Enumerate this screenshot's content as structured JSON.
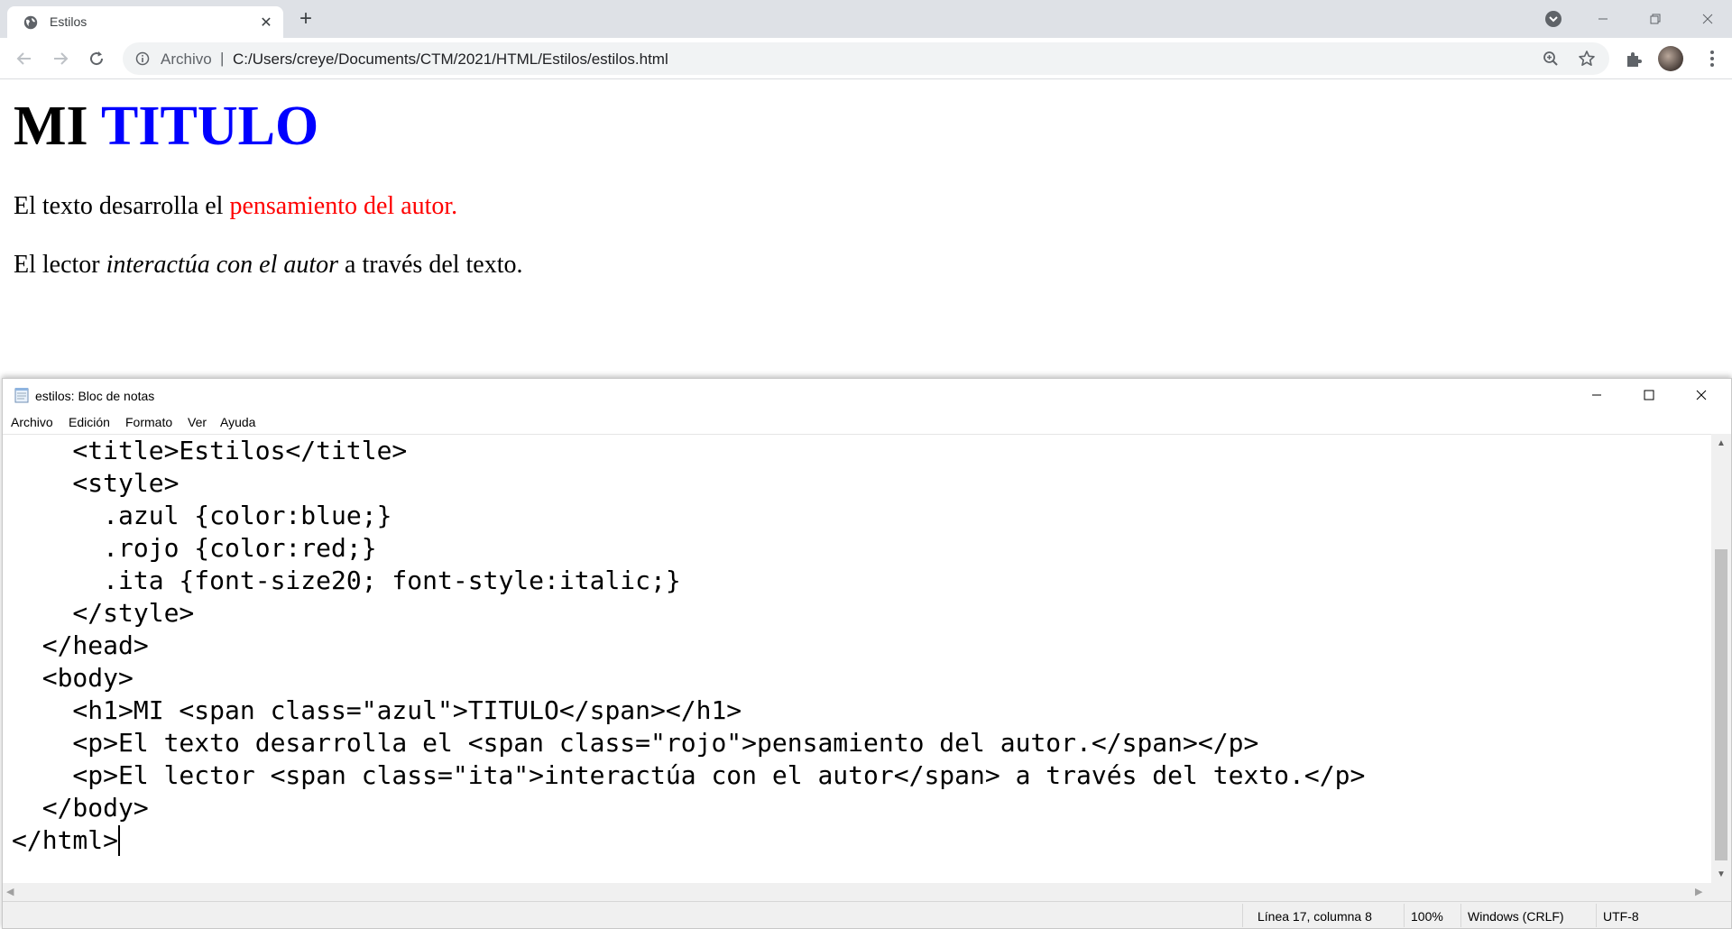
{
  "browser": {
    "tab_title": "Estilos",
    "scheme_label": "Archivo",
    "separator": "|",
    "url": "C:/Users/creye/Documents/CTM/2021/HTML/Estilos/estilos.html"
  },
  "page": {
    "h1_plain": "MI ",
    "h1_blue": "TITULO",
    "p1_plain": "El texto desarrolla el ",
    "p1_red": "pensamiento del autor.",
    "p2_before": "El lector ",
    "p2_italic": "interactúa con el autor",
    "p2_after": " a través del texto.",
    "colors": {
      "azul": "#0000ff",
      "rojo": "#ff0000"
    }
  },
  "notepad": {
    "title": "estilos: Bloc de notas",
    "menu": [
      "Archivo",
      "Edición",
      "Formato",
      "Ver",
      "Ayuda"
    ],
    "code_lines": [
      "    <title>Estilos</title>",
      "    <style>",
      "      .azul {color:blue;}",
      "      .rojo {color:red;}",
      "      .ita {font-size20; font-style:italic;}",
      "    </style>",
      "  </head>",
      "  <body>",
      "    <h1>MI <span class=\"azul\">TITULO</span></h1>",
      "    <p>El texto desarrolla el <span class=\"rojo\">pensamiento del autor.</span></p>",
      "    <p>El lector <span class=\"ita\">interactúa con el autor</span> a través del texto.</p>",
      "  </body>",
      "</html>"
    ],
    "status": {
      "position": "Línea 17, columna 8",
      "zoom": "100%",
      "line_endings": "Windows (CRLF)",
      "encoding": "UTF-8"
    }
  }
}
